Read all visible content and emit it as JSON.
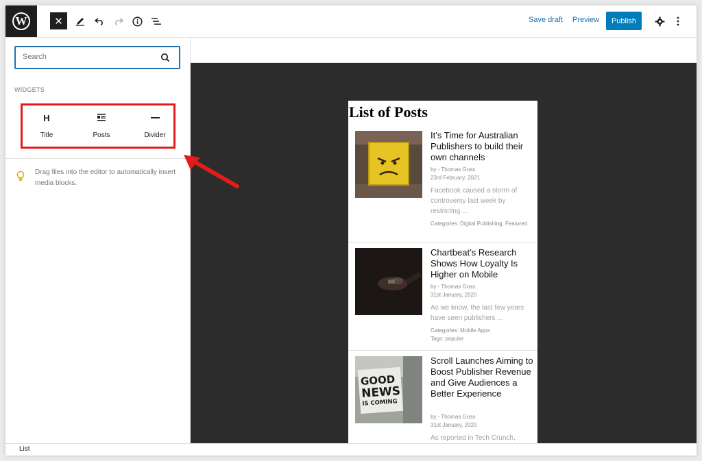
{
  "toolbar": {
    "logo": "W",
    "close": "✕",
    "save_draft": "Save draft",
    "preview": "Preview",
    "publish": "Publish"
  },
  "sidebar": {
    "search_placeholder": "Search",
    "widgets_heading": "WIDGETS",
    "widgets": [
      {
        "label": "Title",
        "icon": "H"
      },
      {
        "label": "Posts",
        "icon": "posts-icon"
      },
      {
        "label": "Divider",
        "icon": "divider-icon"
      }
    ],
    "tip": "Drag files into the editor to automatically insert media blocks."
  },
  "list": {
    "title": "List of Posts",
    "posts": [
      {
        "title": "It’s Time for Australian Publishers to build their own channels",
        "author": "by - Thomas Goss",
        "date": "23rd February, 2021",
        "excerpt": "Facebook caused a storm of controversy last week by restricting ...",
        "categories": "Categories: Digital Publishing, Featured",
        "tags": ""
      },
      {
        "title": "Chartbeat’s Research Shows How Loyalty Is Higher on Mobile",
        "author": "by - Thomas Goss",
        "date": "31st January, 2020",
        "excerpt": "As we know, the last few years have seen publishers ...",
        "categories": "Categories: Mobile Apps",
        "tags": "Tags: popular"
      },
      {
        "title": "Scroll Launches Aiming to Boost Publisher Revenue and Give Audiences a Better Experience",
        "author": "by - Thomas Goss",
        "date": "31st January, 2020",
        "excerpt": "As reported in Tech Crunch,",
        "categories": "",
        "tags": ""
      }
    ],
    "sign_text": [
      "GOOD",
      "NEWS",
      "IS COMING"
    ]
  },
  "footer": {
    "breadcrumb": "List"
  },
  "colors": {
    "accent": "#007cba",
    "highlight": "#e51b1b"
  }
}
